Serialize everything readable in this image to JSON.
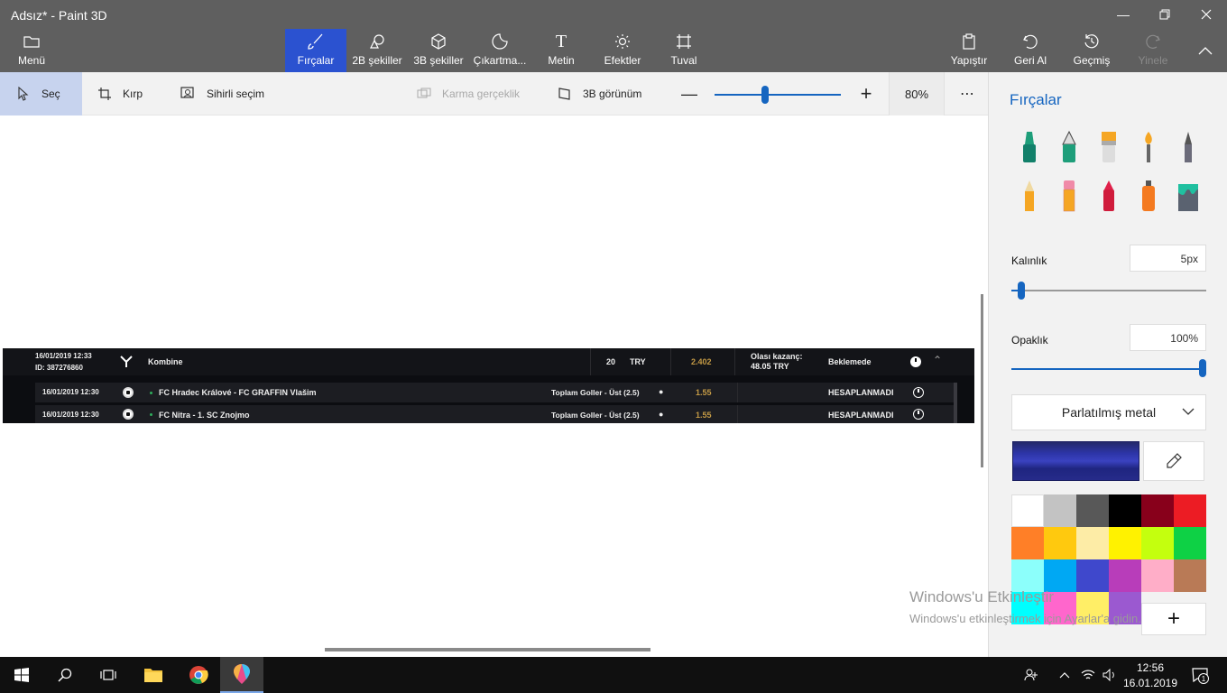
{
  "window": {
    "title": "Adsız* - Paint 3D"
  },
  "ribbon": {
    "menu": "Menü",
    "brushes": "Fırçalar",
    "shapes2d": "2B şekiller",
    "shapes3d": "3B şekiller",
    "stickers": "Çıkartma...",
    "text": "Metin",
    "effects": "Efektler",
    "canvas": "Tuval",
    "paste": "Yapıştır",
    "undo": "Geri Al",
    "history": "Geçmiş",
    "redo": "Yinele"
  },
  "toolbar": {
    "select": "Seç",
    "crop": "Kırp",
    "magic_select": "Sihirli seçim",
    "mixed_reality": "Karma gerçeklik",
    "view3d": "3B görünüm",
    "zoom_percent": "80%",
    "zoom_level": 0.4
  },
  "bet": {
    "header_date": "16/01/2019 12:33",
    "header_id": "ID: 387276860",
    "type": "Kombine",
    "stake": "20",
    "currency": "TRY",
    "odds": "2.402",
    "potential_label": "Olası kazanç:",
    "potential_value": "48.05 TRY",
    "status": "Beklemede",
    "rows": [
      {
        "date": "16/01/2019 12:30",
        "match": "FC Hradec Králové - FC GRAFFIN Vlašim",
        "market": "Toplam Goller - Üst (2.5)",
        "odds": "1.55",
        "result": "HESAPLANMADI"
      },
      {
        "date": "16/01/2019 12:30",
        "match": "FC Nitra - 1. SC Znojmo",
        "market": "Toplam Goller - Üst (2.5)",
        "odds": "1.55",
        "result": "HESAPLANMADI"
      }
    ]
  },
  "panel": {
    "title": "Fırçalar",
    "thickness_label": "Kalınlık",
    "thickness_value": "5px",
    "thickness_level": 0.05,
    "opacity_label": "Opaklık",
    "opacity_value": "100%",
    "opacity_level": 1.0,
    "texture": "Parlatılmış metal",
    "current_color": "#2d35a8",
    "palette": [
      "#ffffff",
      "#c3c3c3",
      "#585858",
      "#000000",
      "#88001b",
      "#ec1c24",
      "#ff7f27",
      "#ffc90e",
      "#fdeca6",
      "#fff200",
      "#c4ff0e",
      "#0ed145",
      "#8cfffb",
      "#00a8f3",
      "#3f48cc",
      "#b83dba",
      "#ffaec8",
      "#b97a56",
      "#00ffff",
      "#ff66cc",
      "#ffee66",
      "#9b59d0"
    ],
    "add_color": "+"
  },
  "watermark": {
    "title": "Windows'u Etkinleştir",
    "body": "Windows'u etkinleştirmek için Ayarlar'a gidin."
  },
  "taskbar": {
    "time": "12:56",
    "date": "16.01.2019",
    "notifications": "1"
  }
}
